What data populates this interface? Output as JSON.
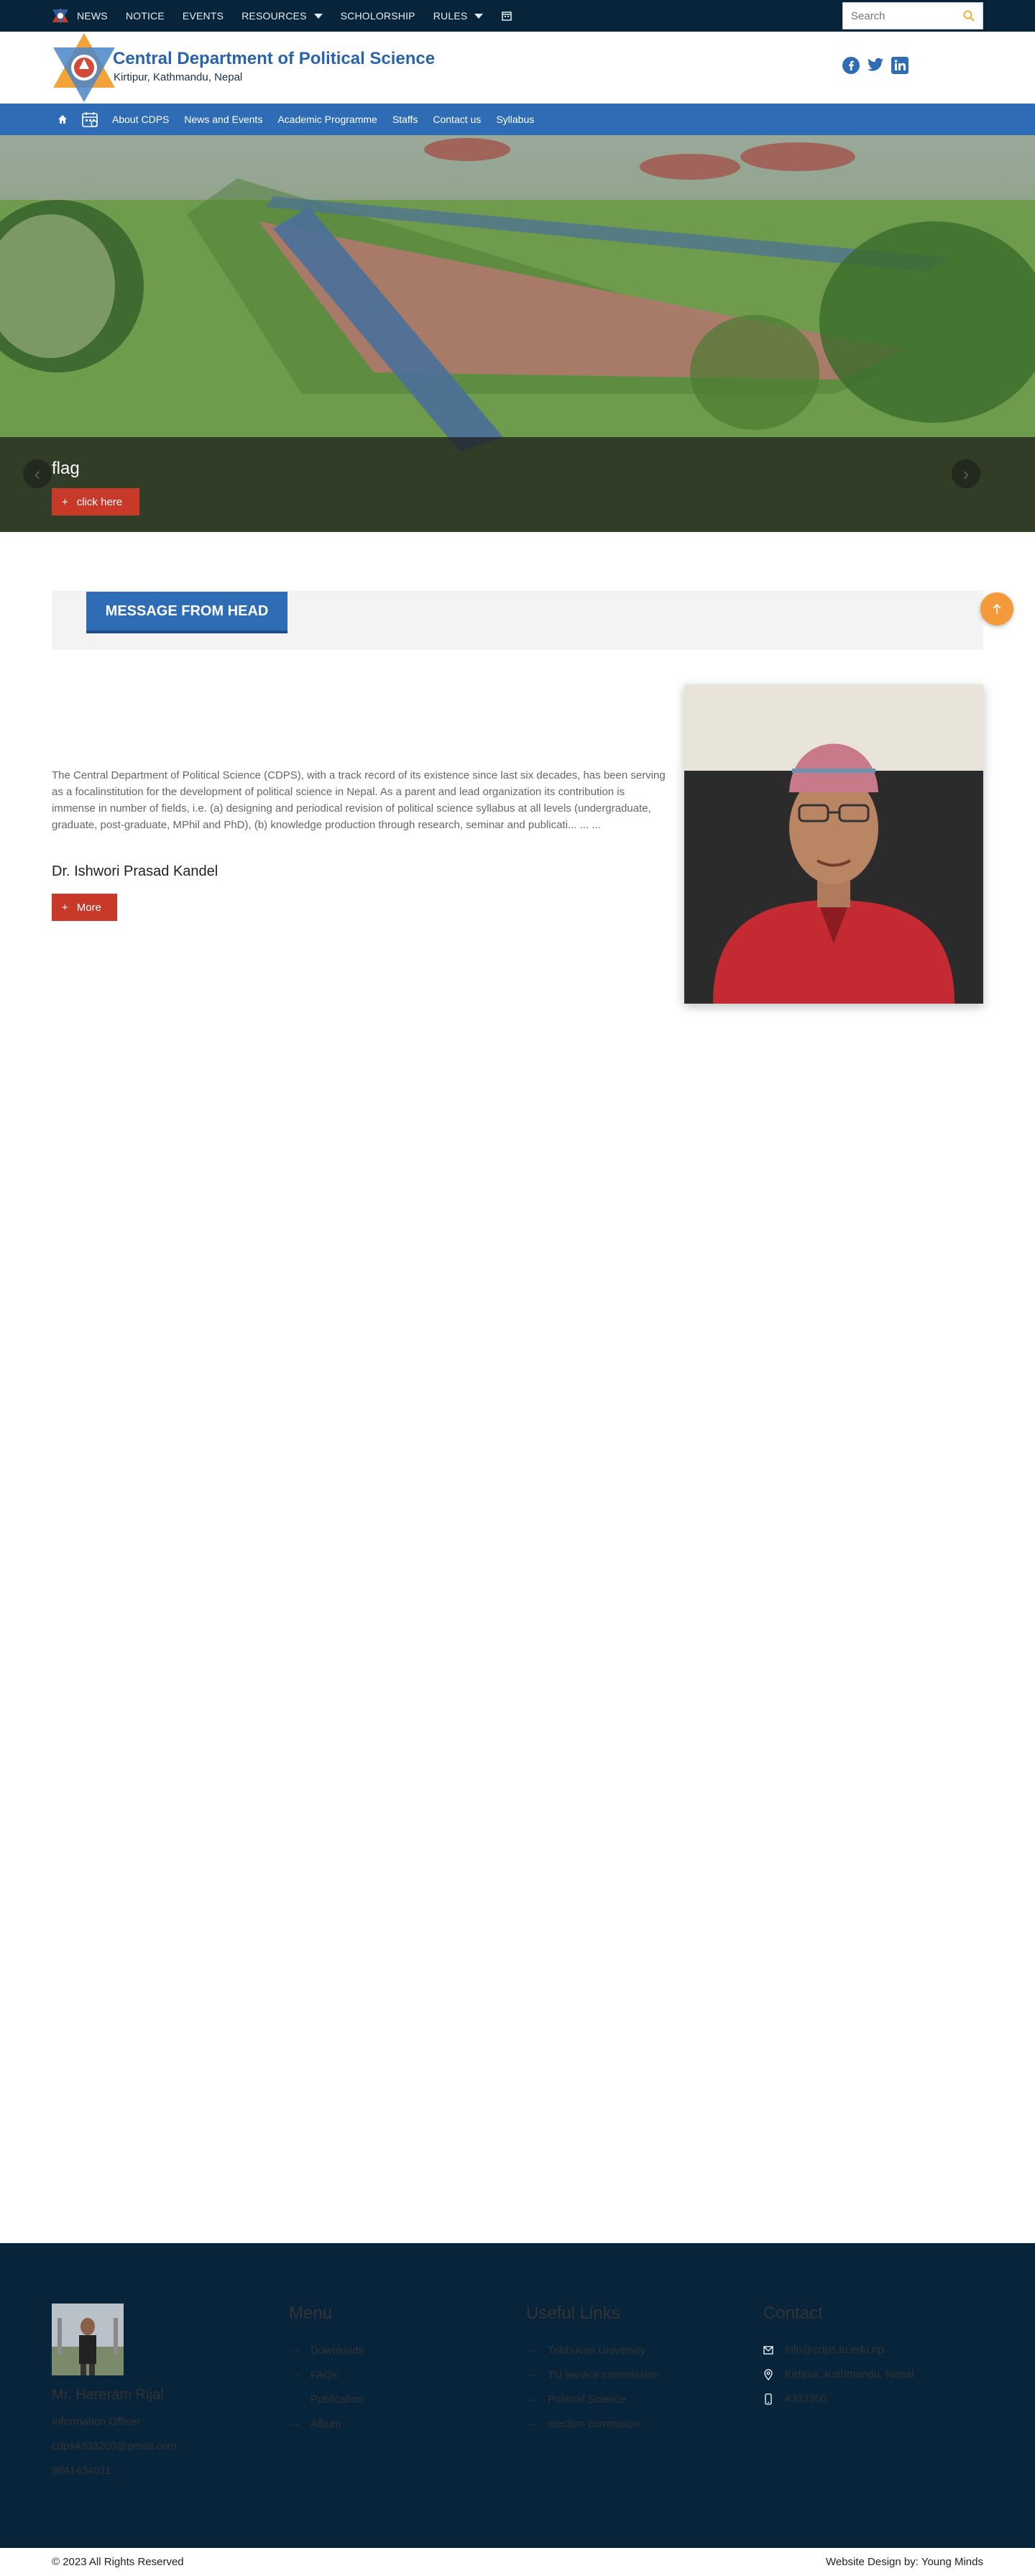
{
  "topnav": {
    "items": [
      {
        "label": "NEWS"
      },
      {
        "label": "NOTICE"
      },
      {
        "label": "EVENTS"
      },
      {
        "label": "RESOURCES",
        "has_caret": true
      },
      {
        "label": "SCHOLORSHIP"
      },
      {
        "label": "RULES",
        "has_caret": true
      }
    ],
    "search_placeholder": "Search"
  },
  "header": {
    "title": "Central Department of Political Science",
    "subtitle": "Kirtipur, Kathmandu, Nepal",
    "social_icons": [
      "facebook-icon",
      "twitter-icon",
      "linkedin-icon"
    ]
  },
  "mainnav": {
    "items": [
      "About CDPS",
      "News and Events",
      "Academic Programme",
      "Staffs",
      "Contact us",
      "Syllabus"
    ]
  },
  "hero": {
    "caption": "flag",
    "button_label": "click here",
    "button_icon": "+",
    "prev": "‹",
    "next": "›"
  },
  "message": {
    "section_title": "MESSAGE FROM HEAD",
    "body": "The Central Department of Political Science (CDPS), with a track record of its existence since last six decades, has been serving as a focalinstitution for the development of political science in Nepal. As a parent and lead organization its contribution is immense in number of fields, i.e. (a) designing and periodical revision of political science syllabus at all levels (undergraduate, graduate, post-graduate, MPhil and PhD), (b) knowledge production through research, seminar and publicati... ... ...",
    "name": "Dr. Ishwori Prasad Kandel",
    "more_label": "More",
    "more_icon": "+"
  },
  "footer": {
    "officer": {
      "name": "Mr. Hareram Rijal",
      "role": "Information Officer",
      "email": "cdps4333200@gmail.com",
      "phone": "9841434011"
    },
    "menu": {
      "title": "Menu",
      "items": [
        "Downloads",
        "FAQs",
        "Publication",
        "Album"
      ]
    },
    "useful_links": {
      "title": "Useful Links",
      "items": [
        "Tribhuvan University",
        "TU service commission",
        "Political Science",
        "election commision"
      ]
    },
    "contact": {
      "title": "Contact",
      "email": "info@cdps.tu.edu.np",
      "address": "Kirtipur, Kathmandu, Nepal",
      "phone": "4333200"
    }
  },
  "bottom": {
    "copyright": "© 2023 All Rights Reserved",
    "credit": "Website Design by: Young Minds"
  },
  "colors": {
    "topbar": "#07243a",
    "nav": "#2f6cb6",
    "accent_red": "#c9392a",
    "scroll_top": "#f59a3a"
  }
}
